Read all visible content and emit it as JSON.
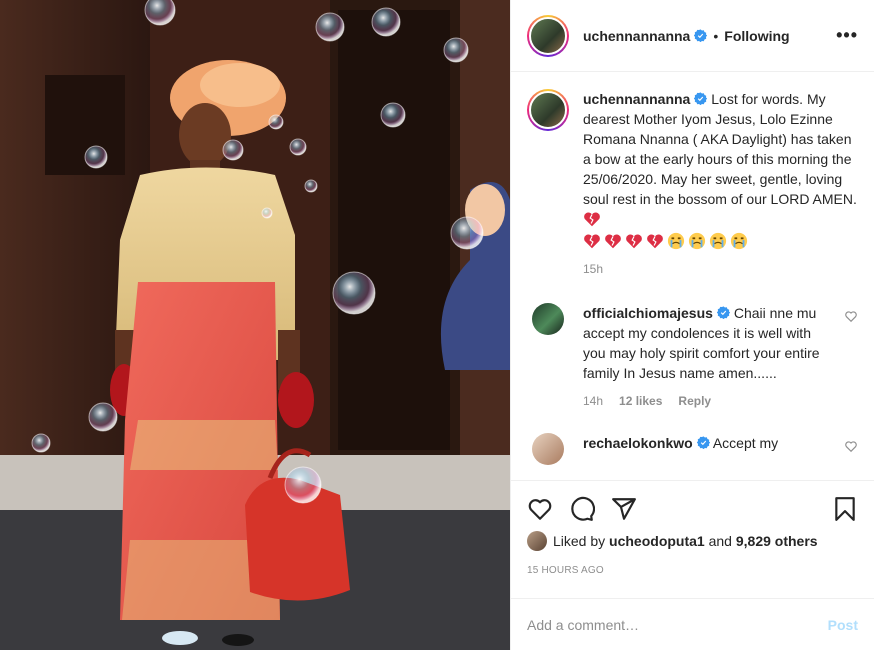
{
  "header": {
    "username": "uchennannanna",
    "separator": "•",
    "follow_status": "Following",
    "more_icon": "more-horizontal-icon"
  },
  "caption": {
    "username": "uchennannanna",
    "text": "Lost for words. My dearest Mother Iyom Jesus, Lolo Ezinne Romana Nnanna ( AKA Daylight) has taken a bow at the early hours of this morning the 25/06/2020. May her sweet, gentle, loving soul rest in the bossom of our LORD AMEN.",
    "emojis": [
      "broken-heart",
      "broken-heart",
      "broken-heart",
      "broken-heart",
      "broken-heart",
      "crying-face",
      "crying-face",
      "crying-face",
      "crying-face"
    ],
    "time": "15h"
  },
  "comments": [
    {
      "username": "officialchiomajesus",
      "text": "Chaii nne mu accept my condolences it is well with you may holy spirit comfort your entire family In Jesus name amen......",
      "time": "14h",
      "likes": "12 likes",
      "reply": "Reply"
    },
    {
      "username": "rechaelokonkwo",
      "text": "Accept my"
    }
  ],
  "actions": {
    "icons": [
      "heart-icon",
      "comment-icon",
      "share-icon",
      "bookmark-icon"
    ]
  },
  "likes": {
    "prefix": "Liked by",
    "user": "ucheodoputa1",
    "middle": "and",
    "others": "9,829 others"
  },
  "timestamp": "15 HOURS AGO",
  "add_comment": {
    "placeholder": "Add a comment…",
    "post_label": "Post"
  },
  "colors": {
    "verified": "#3897f0",
    "broken_heart": "#dd2e44",
    "crying_face": "#ffcc4d",
    "post_disabled": "#b2dffc",
    "muted": "#8e8e8e"
  }
}
